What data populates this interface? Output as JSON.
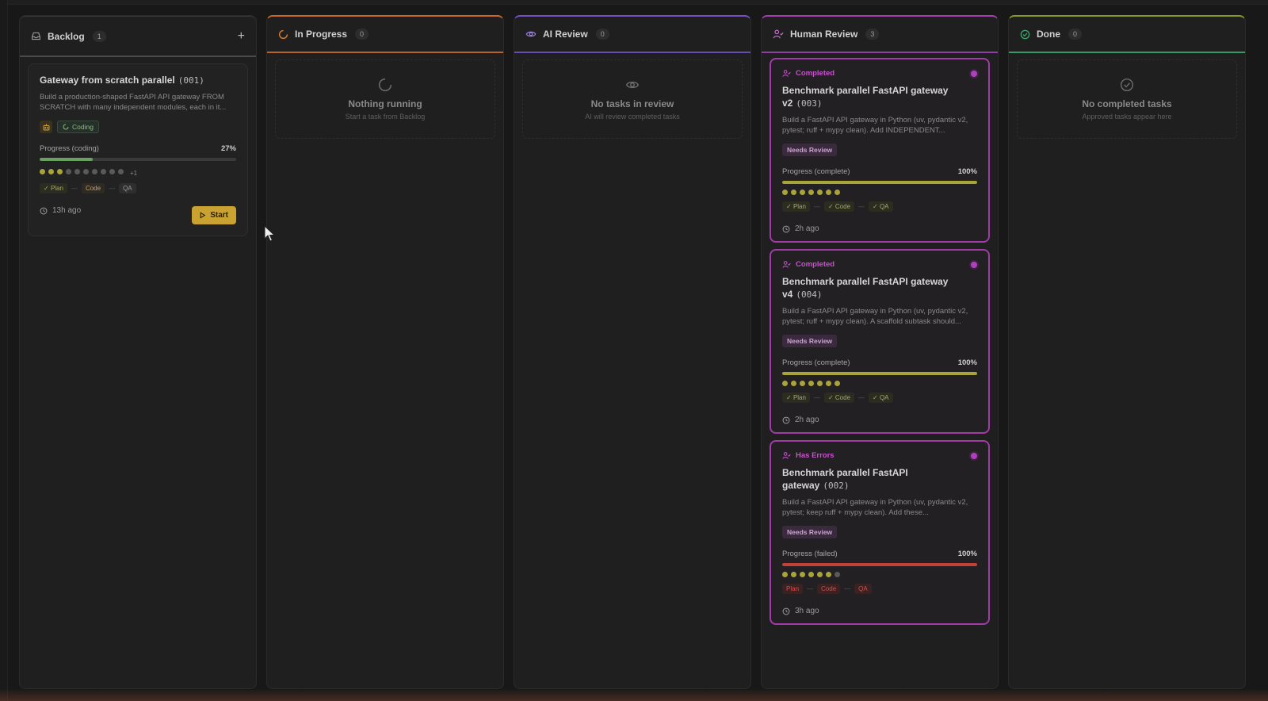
{
  "columns": {
    "backlog": {
      "title": "Backlog",
      "count": "1",
      "add_label": "+"
    },
    "in_progress": {
      "title": "In Progress",
      "count": "0",
      "empty_title": "Nothing running",
      "empty_sub": "Start a task from Backlog"
    },
    "ai_review": {
      "title": "AI Review",
      "count": "0",
      "empty_title": "No tasks in review",
      "empty_sub": "AI will review completed tasks"
    },
    "human_review": {
      "title": "Human Review",
      "count": "3"
    },
    "done": {
      "title": "Done",
      "count": "0",
      "empty_title": "No completed tasks",
      "empty_sub": "Approved tasks appear here"
    }
  },
  "backlog_card": {
    "title": "Gateway from scratch parallel",
    "id": "(001)",
    "desc": "Build a production-shaped FastAPI API gateway FROM SCRATCH with many independent modules, each in it...",
    "badge": "Coding",
    "progress_label": "Progress (coding)",
    "progress_pct": "27%",
    "progress_value": 27,
    "dots_on": 3,
    "dots_total": 10,
    "dots_more": "+1",
    "phases": [
      "Plan",
      "Code",
      "QA"
    ],
    "time": "13h ago",
    "start_label": "Start"
  },
  "review_cards": [
    {
      "status": "Completed",
      "title": "Benchmark parallel FastAPI gateway v2",
      "id": "(003)",
      "desc": "Build a FastAPI API gateway in Python (uv, pydantic v2, pytest; ruff + mypy clean). Add INDEPENDENT...",
      "badge": "Needs Review",
      "progress_label": "Progress (complete)",
      "progress_pct": "100%",
      "progress_value": 100,
      "dots_on": 7,
      "dots_total": 7,
      "phases": [
        "Plan",
        "Code",
        "QA"
      ],
      "time": "2h ago"
    },
    {
      "status": "Completed",
      "title": "Benchmark parallel FastAPI gateway v4",
      "id": "(004)",
      "desc": "Build a FastAPI API gateway in Python (uv, pydantic v2, pytest; ruff + mypy clean). A scaffold subtask should...",
      "badge": "Needs Review",
      "progress_label": "Progress (complete)",
      "progress_pct": "100%",
      "progress_value": 100,
      "dots_on": 7,
      "dots_total": 7,
      "phases": [
        "Plan",
        "Code",
        "QA"
      ],
      "time": "2h ago"
    },
    {
      "status": "Has Errors",
      "title": "Benchmark parallel FastAPI gateway",
      "id": "(002)",
      "desc": "Build a FastAPI API gateway in Python (uv, pydantic v2, pytest; keep ruff + mypy clean). Add these...",
      "badge": "Needs Review",
      "progress_label": "Progress (failed)",
      "progress_pct": "100%",
      "progress_value": 100,
      "dots_on": 6,
      "dots_total": 7,
      "phases": [
        "Plan",
        "Code",
        "QA"
      ],
      "time": "3h ago"
    }
  ],
  "colors": {
    "in_progress_accent": "#c96a28",
    "ai_review_accent": "#7a4fc4",
    "human_review_accent": "#a83fae",
    "done_accent": "#3a9a66",
    "progress_green": "#6aa060",
    "progress_olive": "#a9a43a",
    "progress_error": "#c0403a",
    "start_button": "#c9a232"
  },
  "icons": {
    "backlog": "inbox-icon",
    "in_progress": "spinner-icon",
    "ai_review": "eye-icon",
    "human_review": "user-check-icon",
    "done": "check-circle-icon",
    "clock": "clock-icon",
    "play": "play-icon"
  }
}
